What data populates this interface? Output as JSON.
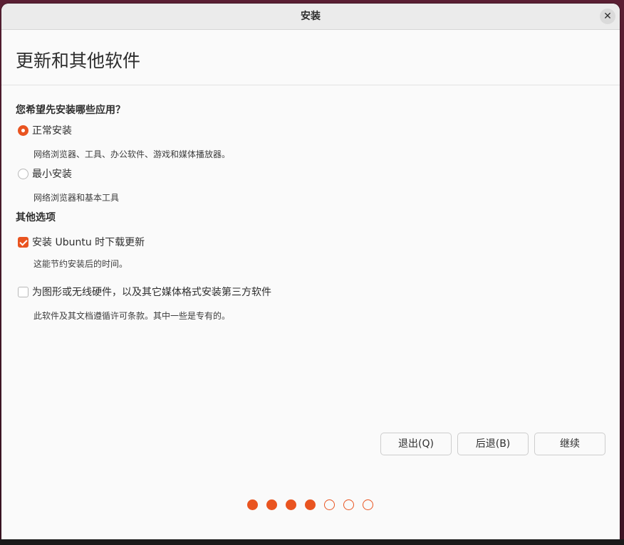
{
  "window": {
    "title": "安装",
    "close_label": "✕"
  },
  "page": {
    "title": "更新和其他软件"
  },
  "install_type": {
    "question": "您希望先安装哪些应用？",
    "options": [
      {
        "label": "正常安装",
        "description": "网络浏览器、工具、办公软件、游戏和媒体播放器。",
        "selected": true
      },
      {
        "label": "最小安装",
        "description": "网络浏览器和基本工具",
        "selected": false
      }
    ]
  },
  "other_options": {
    "heading": "其他选项",
    "items": [
      {
        "label": "安装 Ubuntu 时下载更新",
        "description": "这能节约安装后的时间。",
        "checked": true
      },
      {
        "label": "为图形或无线硬件，以及其它媒体格式安装第三方软件",
        "description": "此软件及其文档遵循许可条款。其中一些是专有的。",
        "checked": false
      }
    ]
  },
  "buttons": {
    "quit": "退出(Q)",
    "back": "后退(B)",
    "continue": "继续"
  },
  "progress": {
    "total_steps": 7,
    "completed_steps": 4
  },
  "colors": {
    "accent": "#e95420"
  }
}
